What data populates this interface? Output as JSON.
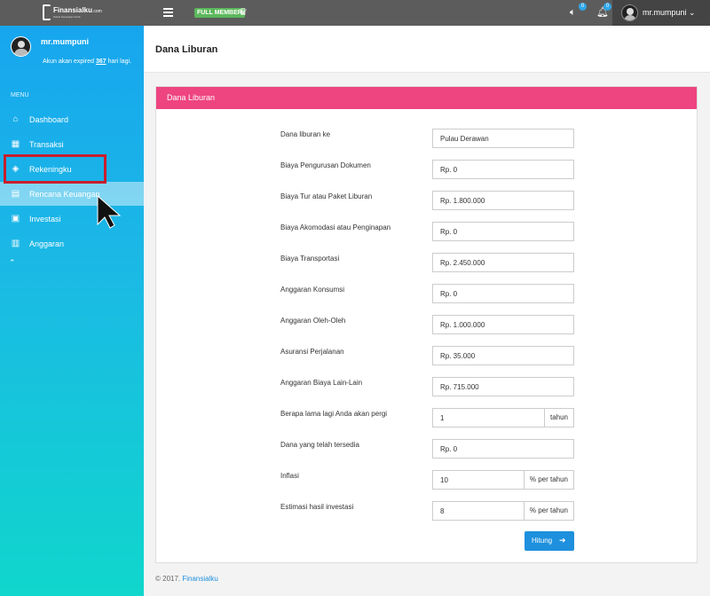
{
  "header": {
    "brand": "Finansialku",
    "brand_suffix": ".com",
    "tagline": "Solusi Keuangan Anda",
    "member_badge": "FULL MEMBER",
    "sound_count": "0",
    "notification_count": "0",
    "username": "mr.mumpuni",
    "dropdown_caret": "⌄"
  },
  "sidebar": {
    "username": "mr.mumpuni",
    "expiry_prefix": "Akun akan expired ",
    "expiry_days": "367",
    "expiry_suffix": " hari lagi.",
    "menu_label": "MENU",
    "items": [
      {
        "label": "Dashboard",
        "icon": "home-icon"
      },
      {
        "label": "Transaksi",
        "icon": "calculator-icon"
      },
      {
        "label": "Rekeningku",
        "icon": "layers-icon"
      },
      {
        "label": "Rencana Keuangan",
        "icon": "clipboard-icon"
      },
      {
        "label": "Investasi",
        "icon": "chart-screen-icon"
      },
      {
        "label": "Anggaran",
        "icon": "grid-icon"
      }
    ],
    "more": "⌃"
  },
  "page": {
    "title": "Dana Liburan",
    "panel_title": "Dana Liburan"
  },
  "form": [
    {
      "label": "Dana liburan ke",
      "value": "Pulau Derawan"
    },
    {
      "label": "Biaya Pengurusan Dokumen",
      "value": "Rp. 0"
    },
    {
      "label": "Biaya Tur atau Paket Liburan",
      "value": "Rp. 1.800.000"
    },
    {
      "label": "Biaya Akomodasi atau Penginapan",
      "value": "Rp. 0"
    },
    {
      "label": "Biaya Transportasi",
      "value": "Rp. 2.450.000"
    },
    {
      "label": "Anggaran Konsumsi",
      "value": "Rp. 0"
    },
    {
      "label": "Anggaran Oleh-Oleh",
      "value": "Rp. 1.000.000"
    },
    {
      "label": "Asuransi Perjalanan",
      "value": "Rp. 35.000"
    },
    {
      "label": "Anggaran Biaya Lain-Lain",
      "value": "Rp. 715.000"
    },
    {
      "label": "Berapa lama lagi Anda akan pergi",
      "value": "1",
      "addon": "tahun"
    },
    {
      "label": "Dana yang telah tersedia",
      "value": "Rp. 0"
    },
    {
      "label": "Inflasi",
      "value": "10",
      "addon": "% per tahun"
    },
    {
      "label": "Estimasi hasil investasi",
      "value": "8",
      "addon": "% per tahun"
    }
  ],
  "submit_label": "Hitung",
  "footer": {
    "copyright": "© 2017. ",
    "link": "Finansialku"
  },
  "colors": {
    "topbar": "#5c5c5c",
    "panel_header": "#ee4480",
    "accent": "#1e90dd",
    "highlight_outline": "#c81e2c"
  }
}
